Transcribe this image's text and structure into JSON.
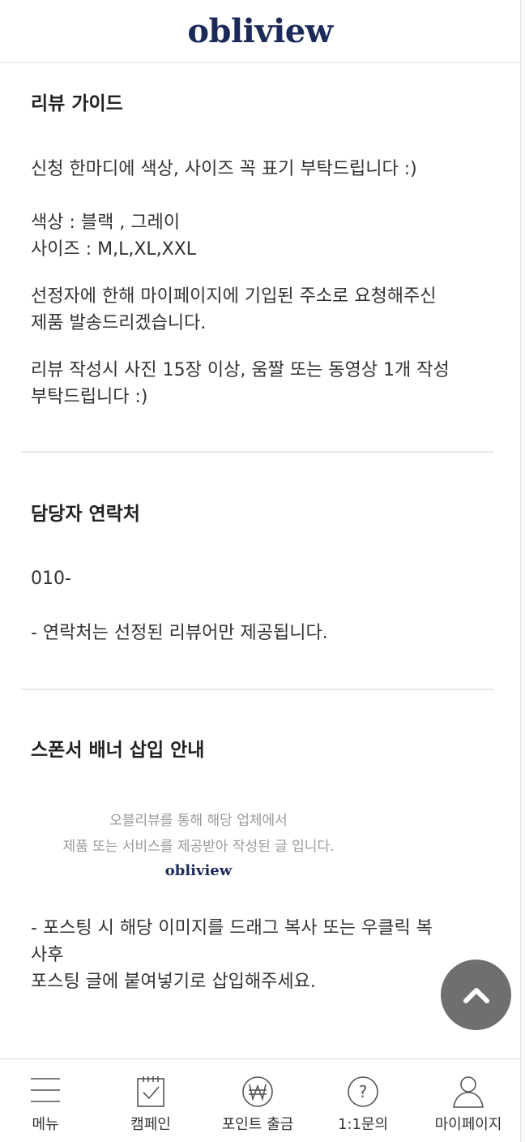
{
  "header": {
    "logo": "obliview"
  },
  "review_guide": {
    "title": "리뷰 가이드",
    "paragraphs": [
      [
        "신청 한마디에 색상, 사이즈 꼭 표기 부탁드립니다 :)"
      ],
      [
        "색상 : 블랙 , 그레이",
        "사이즈 : M,L,XL,XXL"
      ],
      [
        "선정자에 한해 마이페이지에 기입된 주소로 요청해주신",
        "제품 발송드리겠습니다."
      ],
      [
        "리뷰 작성시 사진 15장 이상, 움짤 또는 동영상 1개 작성",
        "부탁드립니다 :)"
      ]
    ]
  },
  "contact": {
    "title": "담당자 연락처",
    "phone": "010-",
    "note": "- 연락처는 선정된 리뷰어만 제공됩니다."
  },
  "sponsor": {
    "title": "스폰서 배너 삽입 안내",
    "banner": {
      "line1": "오블리뷰를 통해 해당 업체에서",
      "line2": "제품 또는 서비스를 제공받아 작성된 글 입니다.",
      "logo": "obliview"
    },
    "instructions": [
      "- 포스팅 시 해당 이미지를 드래그 복사 또는 우클릭 복",
      "사후",
      "포스팅 글에 붙여넣기로 삽입해주세요."
    ]
  },
  "scroll_top": {
    "icon": "chevron-up-icon"
  },
  "bottom_nav": [
    {
      "label": "메뉴",
      "icon": "menu-icon"
    },
    {
      "label": "캠페인",
      "icon": "calendar-check-icon"
    },
    {
      "label": "포인트 출금",
      "icon": "won-coin-icon"
    },
    {
      "label": "1:1문의",
      "icon": "question-icon"
    },
    {
      "label": "마이페이지",
      "icon": "user-icon"
    }
  ]
}
